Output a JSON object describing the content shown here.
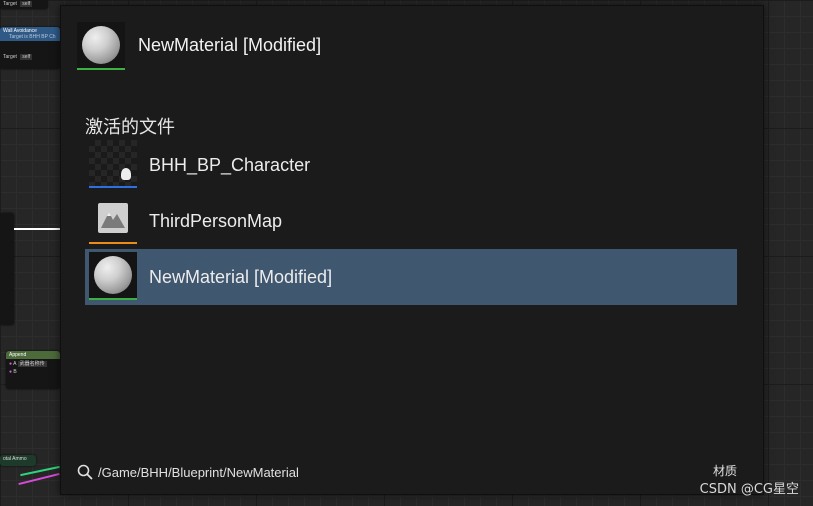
{
  "background_graph": {
    "node_wall": {
      "title": "Wall Avoidance",
      "subtitle": "Target is BHH BP Ch",
      "pin": "Target",
      "pin_value": "self"
    },
    "node_top": {
      "pin": "Target",
      "pin_value": "self"
    },
    "node_append": {
      "title": "Append",
      "pin_a": "A",
      "pin_a_value": "武器名称传",
      "pin_b": "B"
    },
    "node_ammo": {
      "label": "otal Ammo"
    }
  },
  "switcher": {
    "current": {
      "name": "NewMaterial [Modified]",
      "icon": "material-sphere-icon",
      "accent": "#3cb043"
    },
    "section_title": "激活的文件",
    "items": [
      {
        "label": "BHH_BP_Character",
        "icon": "blueprint-character-icon",
        "accent": "#2f6fe0",
        "selected": false
      },
      {
        "label": "ThirdPersonMap",
        "icon": "level-map-icon",
        "accent": "#e98b1d",
        "selected": false
      },
      {
        "label": "NewMaterial [Modified]",
        "icon": "material-sphere-icon",
        "accent": "#3cb043",
        "selected": true
      }
    ],
    "footer": {
      "path": "/Game/BHH/Blueprint/NewMaterial",
      "asset_type": "材质",
      "search_icon": "search-icon"
    },
    "selection_color": "#405770"
  },
  "watermark": "CSDN @CG星空"
}
